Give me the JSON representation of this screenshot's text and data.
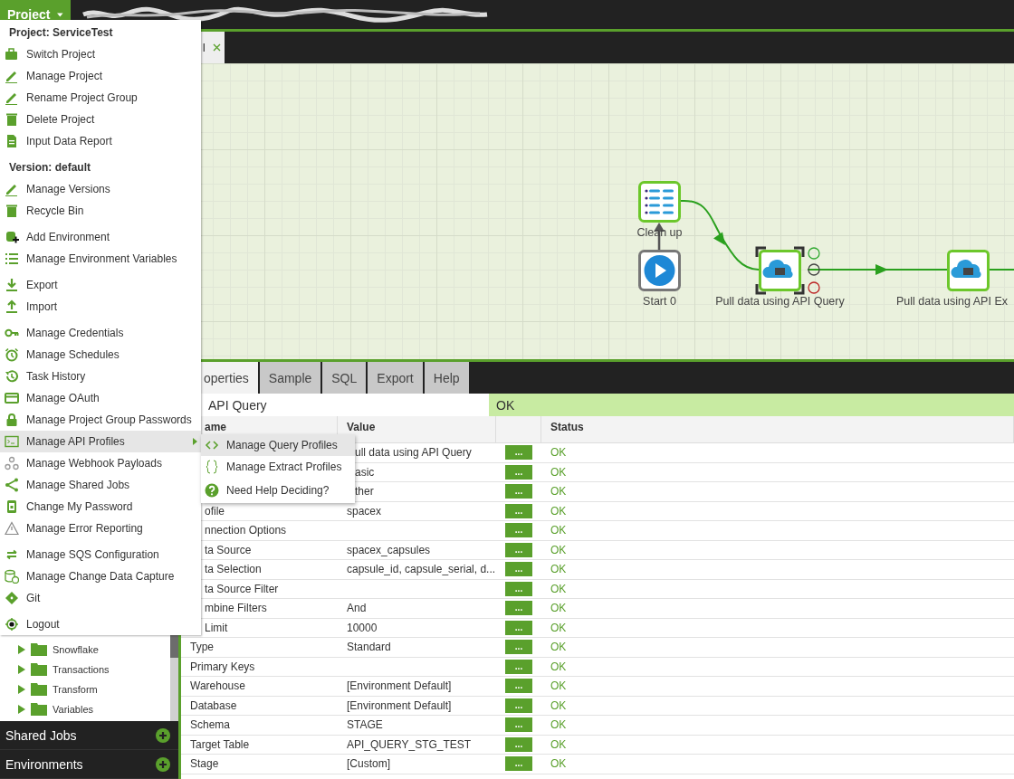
{
  "top_bar": {
    "project_menu": "Project"
  },
  "editor_tabs": [
    {
      "label": "I",
      "selected": true
    }
  ],
  "canvas": {
    "nodes": [
      {
        "label": "Clean up",
        "kind": "list",
        "selected": false
      },
      {
        "label": "Start 0",
        "kind": "start",
        "selected": false
      },
      {
        "label": "Pull data using API Query",
        "kind": "api",
        "selected": true
      },
      {
        "label": "Pull data using API Ex",
        "kind": "api",
        "selected": false
      }
    ]
  },
  "sidebar": {
    "tree": [
      {
        "label": "Snowflake",
        "expanded": false
      },
      {
        "label": "Transactions",
        "expanded": false
      },
      {
        "label": "Transform",
        "expanded": false
      },
      {
        "label": "Variables",
        "expanded": false
      }
    ],
    "panels": [
      {
        "label": "Shared Jobs"
      },
      {
        "label": "Environments"
      }
    ]
  },
  "properties": {
    "tabs": [
      {
        "label": "operties",
        "selected": true
      },
      {
        "label": "Sample",
        "selected": false
      },
      {
        "label": "SQL",
        "selected": false
      },
      {
        "label": "Export",
        "selected": false
      },
      {
        "label": "Help",
        "selected": false
      }
    ],
    "name_field": "API Query",
    "status": "OK",
    "header": {
      "name": "ame",
      "value": "Value",
      "status": "Status"
    },
    "rows": [
      {
        "value": "ull data using API Query",
        "button": "...",
        "status": "OK"
      },
      {
        "value": "asic",
        "button": "...",
        "status": "OK"
      },
      {
        "value": "ther",
        "button": "...",
        "status": "OK"
      },
      {
        "name": "ofile",
        "value": "spacex",
        "button": "...",
        "status": "OK"
      },
      {
        "name": "nnection Options",
        "button": "...",
        "status": "OK"
      },
      {
        "name": "ta Source",
        "value": "spacex_capsules",
        "button": "...",
        "status": "OK"
      },
      {
        "name": "ta Selection",
        "value": "capsule_id, capsule_serial, d...",
        "button": "...",
        "status": "OK"
      },
      {
        "name": "ta Source Filter",
        "button": "...",
        "status": "OK"
      },
      {
        "name": "mbine Filters",
        "value": "And",
        "button": "...",
        "status": "OK"
      },
      {
        "name": "Limit",
        "value": "10000",
        "button": "...",
        "status": "OK"
      },
      {
        "name": "Type",
        "value": "Standard",
        "button": "...",
        "status": "OK"
      },
      {
        "name": "Primary Keys",
        "button": "...",
        "status": "OK"
      },
      {
        "name": "Warehouse",
        "value": "[Environment Default]",
        "button": "...",
        "status": "OK"
      },
      {
        "name": "Database",
        "value": "[Environment Default]",
        "button": "...",
        "status": "OK"
      },
      {
        "name": "Schema",
        "value": "STAGE",
        "button": "...",
        "status": "OK"
      },
      {
        "name": "Target Table",
        "value": "API_QUERY_STG_TEST",
        "button": "...",
        "status": "OK"
      },
      {
        "name": "Stage",
        "value": "[Custom]",
        "button": "...",
        "status": "OK"
      }
    ]
  },
  "menu": {
    "groups": [
      {
        "header": "Project: ServiceTest",
        "items": [
          {
            "label": "Switch Project",
            "selected": false
          },
          {
            "label": "Manage Project",
            "selected": false
          },
          {
            "label": "Rename Project Group",
            "selected": false
          },
          {
            "label": "Delete Project",
            "selected": false
          },
          {
            "label": "Input Data Report",
            "selected": false
          }
        ]
      },
      {
        "header": "Version: default",
        "items": [
          {
            "label": "Manage Versions",
            "selected": false
          },
          {
            "label": "Recycle Bin",
            "selected": false
          }
        ]
      },
      {
        "items": [
          {
            "label": "Add Environment",
            "selected": false
          },
          {
            "label": "Manage Environment Variables",
            "selected": false
          }
        ]
      },
      {
        "items": [
          {
            "label": "Export",
            "selected": false
          },
          {
            "label": "Import",
            "selected": false
          }
        ]
      },
      {
        "items": [
          {
            "label": "Manage Credentials",
            "selected": false
          },
          {
            "label": "Manage Schedules",
            "selected": false
          },
          {
            "label": "Task History",
            "selected": false
          },
          {
            "label": "Manage OAuth",
            "selected": false
          },
          {
            "label": "Manage Project Group Passwords",
            "selected": false
          },
          {
            "label": "Manage API Profiles",
            "selected": true,
            "submenu": [
              {
                "label": "Manage Query Profiles",
                "selected": true
              },
              {
                "label": "Manage Extract Profiles",
                "selected": false
              },
              {
                "label": "Need Help Deciding?",
                "selected": false
              }
            ]
          },
          {
            "label": "Manage Webhook Payloads",
            "selected": false
          },
          {
            "label": "Manage Shared Jobs",
            "selected": false
          },
          {
            "label": "Change My Password",
            "selected": false
          },
          {
            "label": "Manage Error Reporting",
            "selected": false
          }
        ]
      },
      {
        "items": [
          {
            "label": "Manage SQS Configuration",
            "selected": false
          },
          {
            "label": "Manage Change Data Capture",
            "selected": false
          },
          {
            "label": "Git",
            "selected": false
          }
        ]
      },
      {
        "items": [
          {
            "label": "Logout",
            "selected": false
          }
        ]
      }
    ]
  }
}
